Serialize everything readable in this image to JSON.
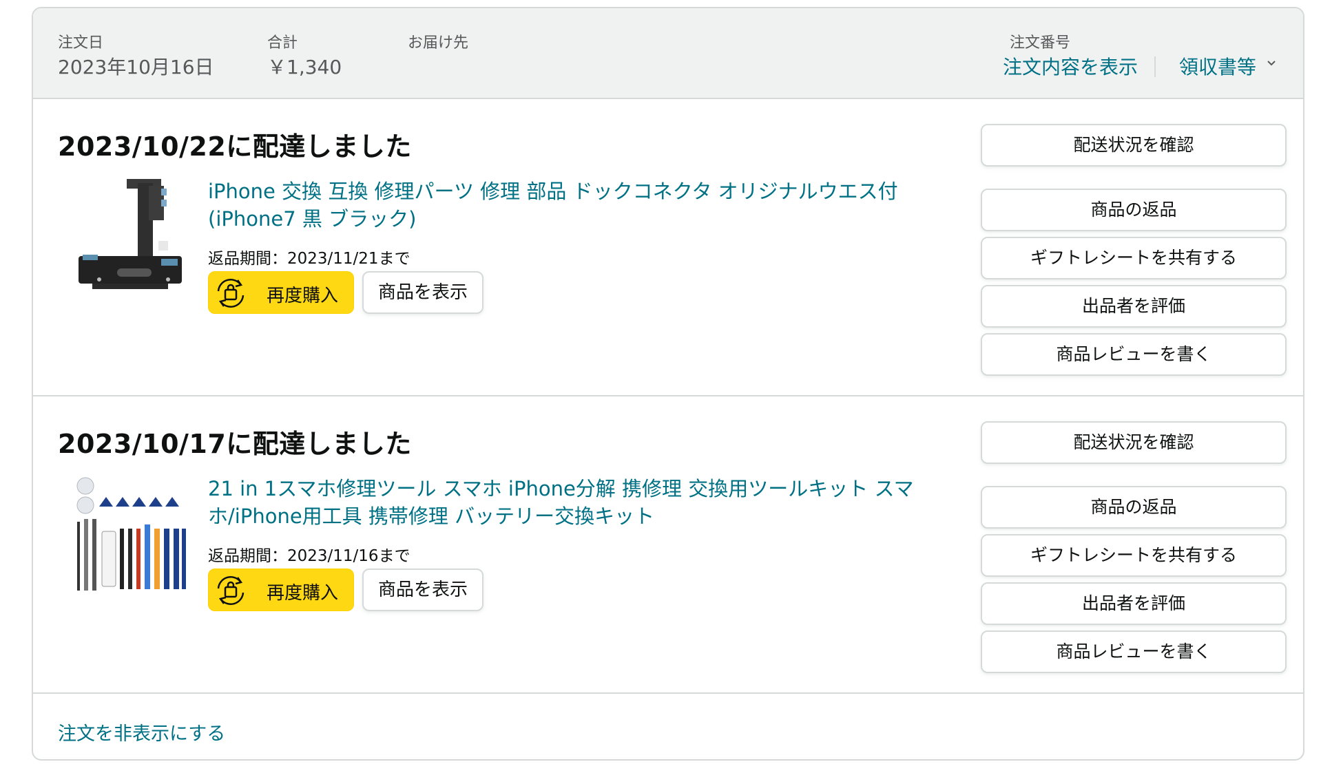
{
  "header": {
    "order_date_label": "注文日",
    "order_date_value": "2023年10月16日",
    "total_label": "合計",
    "total_value": "￥1,340",
    "ship_to_label": "お届け先",
    "order_number_label": "注文番号",
    "view_order_link": "注文内容を表示",
    "receipt_link": "領収書等"
  },
  "shipments": [
    {
      "status": "2023/10/22に配達しました",
      "product_title": "iPhone 交換 互換 修理パーツ 修理 部品 ドックコネクタ オリジナルウエス付 (iPhone7 黒 ブラック)",
      "return_window": "返品期間：2023/11/21まで",
      "buy_again_label": "再度購入",
      "view_product_label": "商品を表示",
      "actions": [
        "配送状況を確認",
        "商品の返品",
        "ギフトレシートを共有する",
        "出品者を評価",
        "商品レビューを書く"
      ]
    },
    {
      "status": "2023/10/17に配達しました",
      "product_title": "21 in 1スマホ修理ツール スマホ iPhone分解 携修理 交換用ツールキット スマホ/iPhone用工具 携帯修理 バッテリー交換キット",
      "return_window": "返品期間：2023/11/16まで",
      "buy_again_label": "再度購入",
      "view_product_label": "商品を表示",
      "actions": [
        "配送状況を確認",
        "商品の返品",
        "ギフトレシートを共有する",
        "出品者を評価",
        "商品レビューを書く"
      ]
    }
  ],
  "footer": {
    "hide_order_link": "注文を非表示にする"
  },
  "icons": {
    "receipt_dropdown": "chevron-down-icon",
    "buy_again": "reorder-bag-icon",
    "product_1": "dock-connector-image",
    "product_2": "repair-toolkit-image"
  },
  "colors": {
    "link": "#007185",
    "buy_again_button": "#ffd814",
    "header_background": "#f0f2f2",
    "border": "#d5d9d9"
  }
}
